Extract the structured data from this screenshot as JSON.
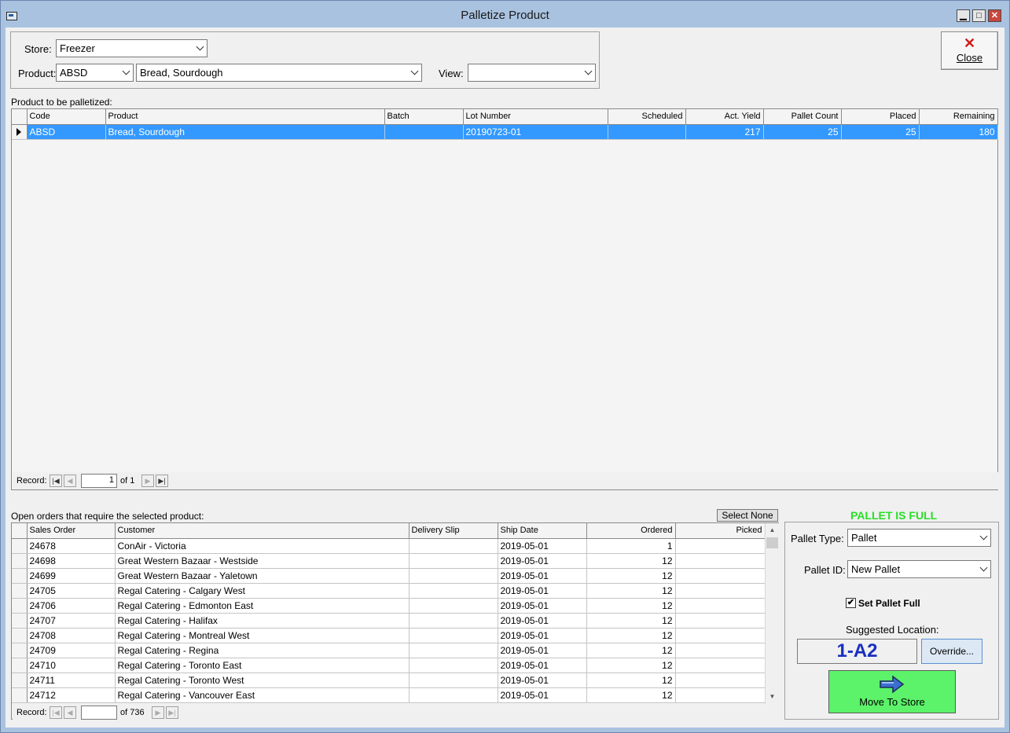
{
  "window": {
    "title": "Palletize Product",
    "min_glyph": "▁",
    "max_glyph": "□",
    "close_glyph": "✕"
  },
  "filters": {
    "store_label": "Store:",
    "store_value": "Freezer",
    "product_label": "Product:",
    "product_code": "ABSD",
    "product_name": "Bread, Sourdough",
    "view_label": "View:",
    "view_value": ""
  },
  "close_button": {
    "icon": "✕",
    "label": "Close"
  },
  "product_grid": {
    "section_label": "Product to be palletized:",
    "columns": [
      "Code",
      "Product",
      "Batch",
      "Lot Number",
      "Scheduled",
      "Act. Yield",
      "Pallet Count",
      "Placed",
      "Remaining"
    ],
    "rows": [
      {
        "code": "ABSD",
        "product": "Bread, Sourdough",
        "batch": "",
        "lot": "20190723-01",
        "scheduled": "",
        "yield": "217",
        "pallet_count": "25",
        "placed": "25",
        "remaining": "180"
      }
    ],
    "nav": {
      "record_label": "Record:",
      "current": "1",
      "of_text": "of 1"
    }
  },
  "orders_grid": {
    "section_label": "Open orders that require the selected product:",
    "select_none": "Select None",
    "columns": [
      "Sales Order",
      "Customer",
      "Delivery Slip",
      "Ship Date",
      "Ordered",
      "Picked"
    ],
    "rows": [
      {
        "so": "24678",
        "customer": "ConAir - Victoria",
        "slip": "",
        "ship": "2019-05-01",
        "ordered": "1",
        "picked": ""
      },
      {
        "so": "24698",
        "customer": "Great Western Bazaar - Westside",
        "slip": "",
        "ship": "2019-05-01",
        "ordered": "12",
        "picked": ""
      },
      {
        "so": "24699",
        "customer": "Great Western Bazaar - Yaletown",
        "slip": "",
        "ship": "2019-05-01",
        "ordered": "12",
        "picked": ""
      },
      {
        "so": "24705",
        "customer": "Regal Catering - Calgary West",
        "slip": "",
        "ship": "2019-05-01",
        "ordered": "12",
        "picked": ""
      },
      {
        "so": "24706",
        "customer": "Regal Catering - Edmonton East",
        "slip": "",
        "ship": "2019-05-01",
        "ordered": "12",
        "picked": ""
      },
      {
        "so": "24707",
        "customer": "Regal Catering - Halifax",
        "slip": "",
        "ship": "2019-05-01",
        "ordered": "12",
        "picked": ""
      },
      {
        "so": "24708",
        "customer": "Regal Catering - Montreal West",
        "slip": "",
        "ship": "2019-05-01",
        "ordered": "12",
        "picked": ""
      },
      {
        "so": "24709",
        "customer": "Regal Catering - Regina",
        "slip": "",
        "ship": "2019-05-01",
        "ordered": "12",
        "picked": ""
      },
      {
        "so": "24710",
        "customer": "Regal Catering - Toronto East",
        "slip": "",
        "ship": "2019-05-01",
        "ordered": "12",
        "picked": ""
      },
      {
        "so": "24711",
        "customer": "Regal Catering - Toronto West",
        "slip": "",
        "ship": "2019-05-01",
        "ordered": "12",
        "picked": ""
      },
      {
        "so": "24712",
        "customer": "Regal Catering - Vancouver East",
        "slip": "",
        "ship": "2019-05-01",
        "ordered": "12",
        "picked": ""
      }
    ],
    "nav": {
      "record_label": "Record:",
      "current": "",
      "of_text": "of 736"
    }
  },
  "pallet_panel": {
    "status": "PALLET IS FULL",
    "status_color": "#26e026",
    "type_label": "Pallet Type:",
    "type_value": "Pallet",
    "id_label": "Pallet ID:",
    "id_value": "New Pallet",
    "set_full_label": "Set Pallet Full",
    "set_full_checked": "✔",
    "suggested_label": "Suggested Location:",
    "location": "1-A2",
    "override": "Override...",
    "move": "Move To Store",
    "move_icon": "arrow-right-icon"
  },
  "nav_glyphs": {
    "first": "|◀",
    "prev": "◀",
    "next": "▶",
    "last": "▶|",
    "up": "▲",
    "down": "▼"
  }
}
